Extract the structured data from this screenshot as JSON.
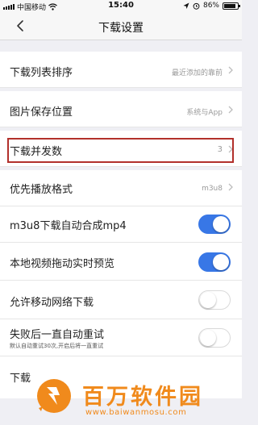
{
  "status_bar": {
    "carrier": "中国移动",
    "time": "15:40",
    "battery": "86%",
    "battery_level": 0.86,
    "icons": [
      "signal-icon",
      "wifi-icon",
      "location-icon",
      "alarm-icon",
      "battery-icon"
    ]
  },
  "nav": {
    "title": "下载设置",
    "back_icon": "chevron-left-icon"
  },
  "settings": {
    "download_sort": {
      "label": "下载列表排序",
      "value": "最近添加的靠前"
    },
    "image_save_location": {
      "label": "图片保存位置",
      "value": "系统与App"
    },
    "concurrent_downloads": {
      "label": "下载并发数",
      "value": "3"
    },
    "preferred_format": {
      "label": "优先播放格式",
      "value": "m3u8"
    },
    "auto_merge_mp4": {
      "label": "m3u8下载自动合成mp4",
      "enabled": true
    },
    "local_preview": {
      "label": "本地视频拖动实时预览",
      "enabled": true
    },
    "mobile_network": {
      "label": "允许移动网络下载",
      "enabled": false
    },
    "auto_retry": {
      "label": "失败后一直自动重试",
      "sublabel": "默认自动重试30次,开启后将一直重试",
      "enabled": false
    },
    "last_row": {
      "label": "下载"
    }
  },
  "colors": {
    "toggle_on": "#3877e6",
    "highlight": "#b2302b",
    "watermark": "#f08a1c"
  },
  "watermark": {
    "text": "百万软件园",
    "url": "www.baiwanmosu.com"
  }
}
